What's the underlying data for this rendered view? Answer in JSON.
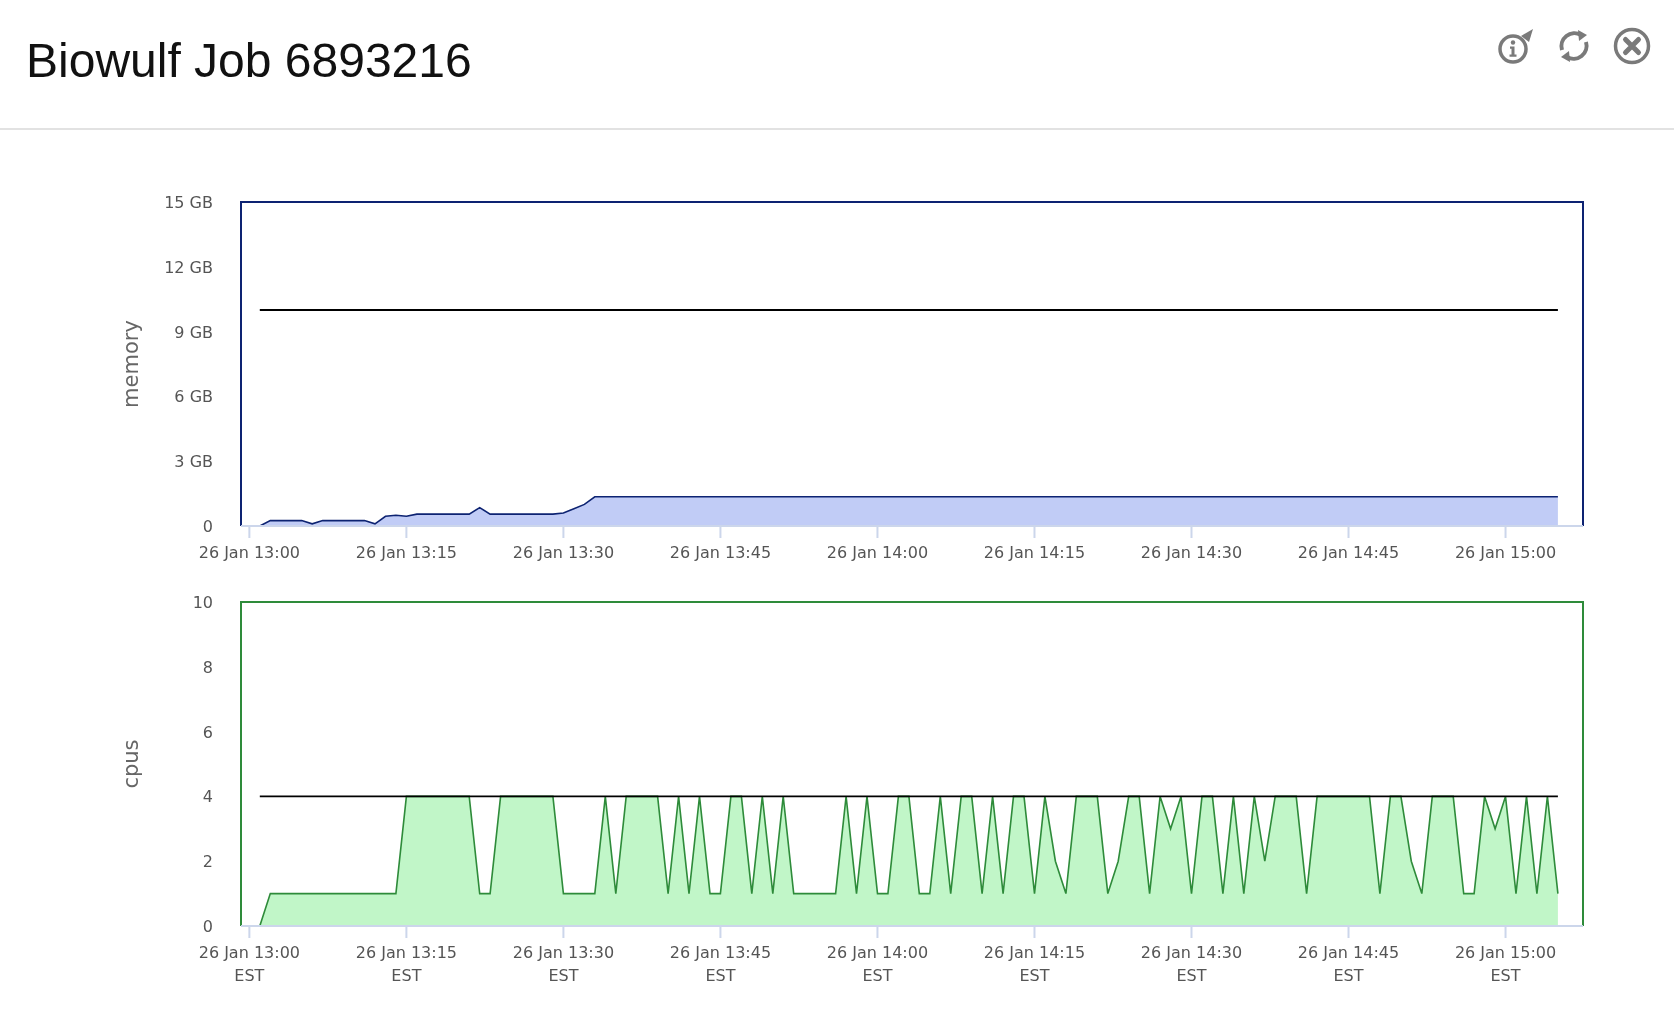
{
  "window": {
    "title": "Biowulf Job 6893216"
  },
  "charts": [
    {
      "chart_data": {
        "type": "area",
        "ylabel": "memory",
        "ylim": [
          0,
          15
        ],
        "yticks": [
          {
            "value": 0,
            "label": "0"
          },
          {
            "value": 3,
            "label": "3 GB"
          },
          {
            "value": 6,
            "label": "6 GB"
          },
          {
            "value": 9,
            "label": "9 GB"
          },
          {
            "value": 12,
            "label": "12 GB"
          },
          {
            "value": 15,
            "label": "15 GB"
          }
        ],
        "categories": [
          "26 Jan 13:00",
          null,
          null,
          null,
          null,
          null,
          null,
          null,
          null,
          null,
          null,
          null,
          null,
          null,
          null,
          "26 Jan 13:15",
          null,
          null,
          null,
          null,
          null,
          null,
          null,
          null,
          null,
          null,
          null,
          null,
          null,
          null,
          "26 Jan 13:30",
          null,
          null,
          null,
          null,
          null,
          null,
          null,
          null,
          null,
          null,
          null,
          null,
          null,
          null,
          "26 Jan 13:45",
          null,
          null,
          null,
          null,
          null,
          null,
          null,
          null,
          null,
          null,
          null,
          null,
          null,
          null,
          "26 Jan 14:00",
          null,
          null,
          null,
          null,
          null,
          null,
          null,
          null,
          null,
          null,
          null,
          null,
          null,
          null,
          "26 Jan 14:15",
          null,
          null,
          null,
          null,
          null,
          null,
          null,
          null,
          null,
          null,
          null,
          null,
          null,
          null,
          "26 Jan 14:30",
          null,
          null,
          null,
          null,
          null,
          null,
          null,
          null,
          null,
          null,
          null,
          null,
          null,
          null,
          "26 Jan 14:45",
          null,
          null,
          null,
          null,
          null,
          null,
          null,
          null,
          null,
          null,
          null,
          null,
          null,
          null,
          "26 Jan 15:00",
          null,
          null,
          null,
          null,
          null
        ],
        "series": [
          {
            "type": "area",
            "color": "#0d2372",
            "values": [
              null,
              0,
              0.25,
              0.25,
              0.25,
              0.25,
              0.1,
              0.25,
              0.25,
              0.25,
              0.25,
              0.25,
              0.1,
              0.45,
              0.5,
              0.45,
              0.55,
              0.55,
              0.55,
              0.55,
              0.55,
              0.55,
              0.85,
              0.55,
              0.55,
              0.55,
              0.55,
              0.55,
              0.55,
              0.55,
              0.6,
              0.8,
              1.0,
              1.35,
              1.35,
              1.35,
              1.35,
              1.35,
              1.35,
              1.35,
              1.35,
              1.35,
              1.35,
              1.35,
              1.35,
              1.35,
              1.35,
              1.35,
              1.35,
              1.35,
              1.35,
              1.35,
              1.35,
              1.35,
              1.35,
              1.35,
              1.35,
              1.35,
              1.35,
              1.35,
              1.35,
              1.35,
              1.35,
              1.35,
              1.35,
              1.35,
              1.35,
              1.35,
              1.35,
              1.35,
              1.35,
              1.35,
              1.35,
              1.35,
              1.35,
              1.35,
              1.35,
              1.35,
              1.35,
              1.35,
              1.35,
              1.35,
              1.35,
              1.35,
              1.35,
              1.35,
              1.35,
              1.35,
              1.35,
              1.35,
              1.35,
              1.35,
              1.35,
              1.35,
              1.35,
              1.35,
              1.35,
              1.35,
              1.35,
              1.35,
              1.35,
              1.35,
              1.35,
              1.35,
              1.35,
              1.35,
              1.35,
              1.35,
              1.35,
              1.35,
              1.35,
              1.35,
              1.35,
              1.35,
              1.35,
              1.35,
              1.35,
              1.35,
              1.35,
              1.35,
              1.35,
              1.35,
              1.35,
              1.35,
              1.35,
              1.35
            ]
          },
          {
            "type": "line",
            "color": "#000000",
            "values": [
              null,
              10,
              10,
              10,
              10,
              10,
              10,
              10,
              10,
              10,
              10,
              10,
              10,
              10,
              10,
              10,
              10,
              10,
              10,
              10,
              10,
              10,
              10,
              10,
              10,
              10,
              10,
              10,
              10,
              10,
              10,
              10,
              10,
              10,
              10,
              10,
              10,
              10,
              10,
              10,
              10,
              10,
              10,
              10,
              10,
              10,
              10,
              10,
              10,
              10,
              10,
              10,
              10,
              10,
              10,
              10,
              10,
              10,
              10,
              10,
              10,
              10,
              10,
              10,
              10,
              10,
              10,
              10,
              10,
              10,
              10,
              10,
              10,
              10,
              10,
              10,
              10,
              10,
              10,
              10,
              10,
              10,
              10,
              10,
              10,
              10,
              10,
              10,
              10,
              10,
              10,
              10,
              10,
              10,
              10,
              10,
              10,
              10,
              10,
              10,
              10,
              10,
              10,
              10,
              10,
              10,
              10,
              10,
              10,
              10,
              10,
              10,
              10,
              10,
              10,
              10,
              10,
              10,
              10,
              10,
              10,
              10,
              10,
              10,
              10,
              10
            ]
          }
        ]
      }
    },
    {
      "chart_data": {
        "type": "area",
        "ylabel": "cpus",
        "ylim": [
          0,
          10
        ],
        "yticks": [
          0,
          2,
          4,
          6,
          8,
          10
        ],
        "categories": [
          "26 Jan 13:00\nEST",
          null,
          null,
          null,
          null,
          null,
          null,
          null,
          null,
          null,
          null,
          null,
          null,
          null,
          null,
          "26 Jan 13:15\nEST",
          null,
          null,
          null,
          null,
          null,
          null,
          null,
          null,
          null,
          null,
          null,
          null,
          null,
          null,
          "26 Jan 13:30\nEST",
          null,
          null,
          null,
          null,
          null,
          null,
          null,
          null,
          null,
          null,
          null,
          null,
          null,
          null,
          "26 Jan 13:45\nEST",
          null,
          null,
          null,
          null,
          null,
          null,
          null,
          null,
          null,
          null,
          null,
          null,
          null,
          null,
          "26 Jan 14:00\nEST",
          null,
          null,
          null,
          null,
          null,
          null,
          null,
          null,
          null,
          null,
          null,
          null,
          null,
          null,
          "26 Jan 14:15\nEST",
          null,
          null,
          null,
          null,
          null,
          null,
          null,
          null,
          null,
          null,
          null,
          null,
          null,
          null,
          "26 Jan 14:30\nEST",
          null,
          null,
          null,
          null,
          null,
          null,
          null,
          null,
          null,
          null,
          null,
          null,
          null,
          null,
          "26 Jan 14:45\nEST",
          null,
          null,
          null,
          null,
          null,
          null,
          null,
          null,
          null,
          null,
          null,
          null,
          null,
          null,
          "26 Jan 15:00\nEST",
          null,
          null,
          null,
          null,
          null
        ],
        "series": [
          {
            "type": "area",
            "color": "#2e8b3a",
            "values": [
              null,
              0,
              1,
              1,
              1,
              1,
              1,
              1,
              1,
              1,
              1,
              1,
              1,
              1,
              1,
              4,
              4,
              4,
              4,
              4,
              4,
              4,
              1,
              1,
              4,
              4,
              4,
              4,
              4,
              4,
              1,
              1,
              1,
              1,
              4,
              1,
              4,
              4,
              4,
              4,
              1,
              4,
              1,
              4,
              1,
              1,
              4,
              4,
              1,
              4,
              1,
              4,
              1,
              1,
              1,
              1,
              1,
              4,
              1,
              4,
              1,
              1,
              4,
              4,
              1,
              1,
              4,
              1,
              4,
              4,
              1,
              4,
              1,
              4,
              4,
              1,
              4,
              2,
              1,
              4,
              4,
              4,
              1,
              2,
              4,
              4,
              1,
              4,
              3,
              4,
              1,
              4,
              4,
              1,
              4,
              1,
              4,
              2,
              4,
              4,
              4,
              1,
              4,
              4,
              4,
              4,
              4,
              4,
              1,
              4,
              4,
              2,
              1,
              4,
              4,
              4,
              1,
              1,
              4,
              3,
              4,
              1,
              4,
              1,
              4,
              1
            ]
          },
          {
            "type": "line",
            "color": "#000000",
            "values": [
              null,
              4,
              4,
              4,
              4,
              4,
              4,
              4,
              4,
              4,
              4,
              4,
              4,
              4,
              4,
              4,
              4,
              4,
              4,
              4,
              4,
              4,
              4,
              4,
              4,
              4,
              4,
              4,
              4,
              4,
              4,
              4,
              4,
              4,
              4,
              4,
              4,
              4,
              4,
              4,
              4,
              4,
              4,
              4,
              4,
              4,
              4,
              4,
              4,
              4,
              4,
              4,
              4,
              4,
              4,
              4,
              4,
              4,
              4,
              4,
              4,
              4,
              4,
              4,
              4,
              4,
              4,
              4,
              4,
              4,
              4,
              4,
              4,
              4,
              4,
              4,
              4,
              4,
              4,
              4,
              4,
              4,
              4,
              4,
              4,
              4,
              4,
              4,
              4,
              4,
              4,
              4,
              4,
              4,
              4,
              4,
              4,
              4,
              4,
              4,
              4,
              4,
              4,
              4,
              4,
              4,
              4,
              4,
              4,
              4,
              4,
              4,
              4,
              4,
              4,
              4,
              4,
              4,
              4,
              4,
              4,
              4,
              4,
              4,
              4,
              4
            ]
          }
        ]
      }
    }
  ]
}
